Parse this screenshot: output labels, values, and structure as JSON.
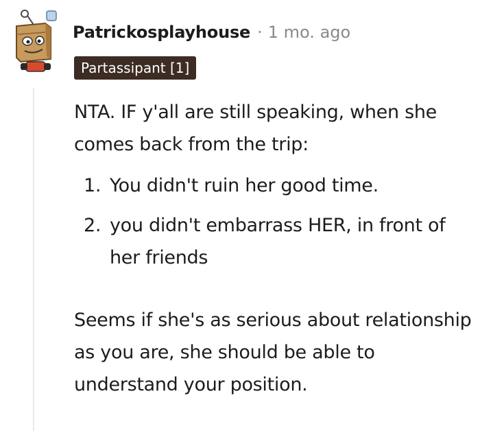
{
  "comment": {
    "author": "Patrickosplayhouse",
    "separator": "·",
    "time": "1 mo. ago",
    "flair": "Partassipant [1]",
    "paragraph1": "NTA. IF y'all are still speaking, when she comes back from the trip:",
    "list": [
      {
        "num": "1.",
        "text": "You didn't ruin her good time."
      },
      {
        "num": "2.",
        "text": "you didn't embarrass HER, in front of her friends"
      }
    ],
    "paragraph2": "Seems if she's as serious about relationship as you are, she should be able to understand your position."
  },
  "colors": {
    "flair_bg": "#3d2c24",
    "meta_gray": "#878a8c",
    "thread_line": "#e8e8e8",
    "text": "#1c1c1c"
  },
  "icons": {
    "avatar": "snoo-avatar-boxhead"
  }
}
